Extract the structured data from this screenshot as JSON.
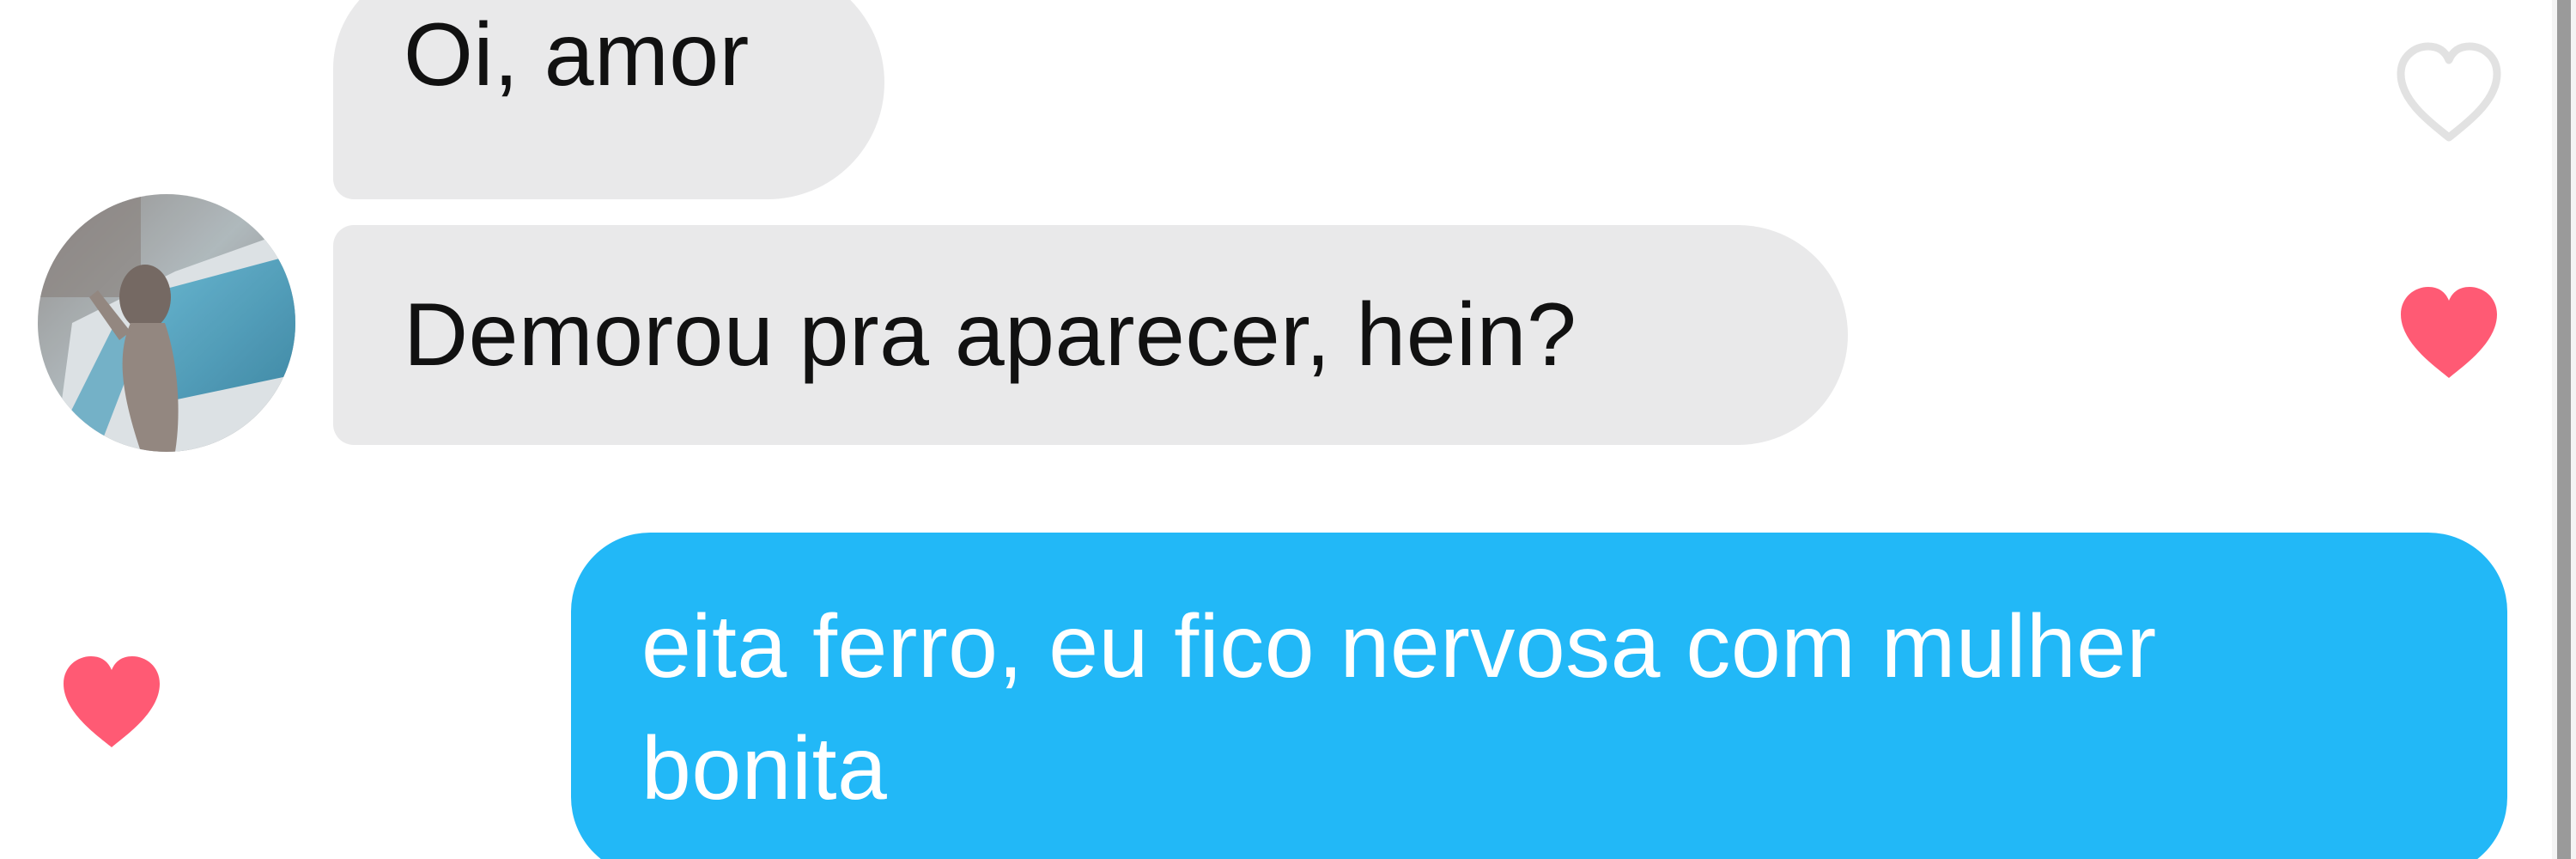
{
  "conversation": {
    "messages": [
      {
        "sender": "other",
        "text": "Oi, amor",
        "liked": false
      },
      {
        "sender": "other",
        "text": "Demorou pra aparecer, hein?",
        "liked": true
      },
      {
        "sender": "me",
        "lines": [
          "eita ferro, eu fico nervosa com mulher",
          "bonita"
        ],
        "liked": true
      }
    ]
  },
  "icons": {
    "avatar": "contact-avatar",
    "like_empty": "heart-outline-icon",
    "like_filled": "heart-filled-icon"
  },
  "colors": {
    "incoming_bubble": "#e9e9ea",
    "outgoing_bubble": "#22b8f7",
    "heart_filled": "#ff5a74",
    "heart_outline": "#e2e2e2"
  }
}
